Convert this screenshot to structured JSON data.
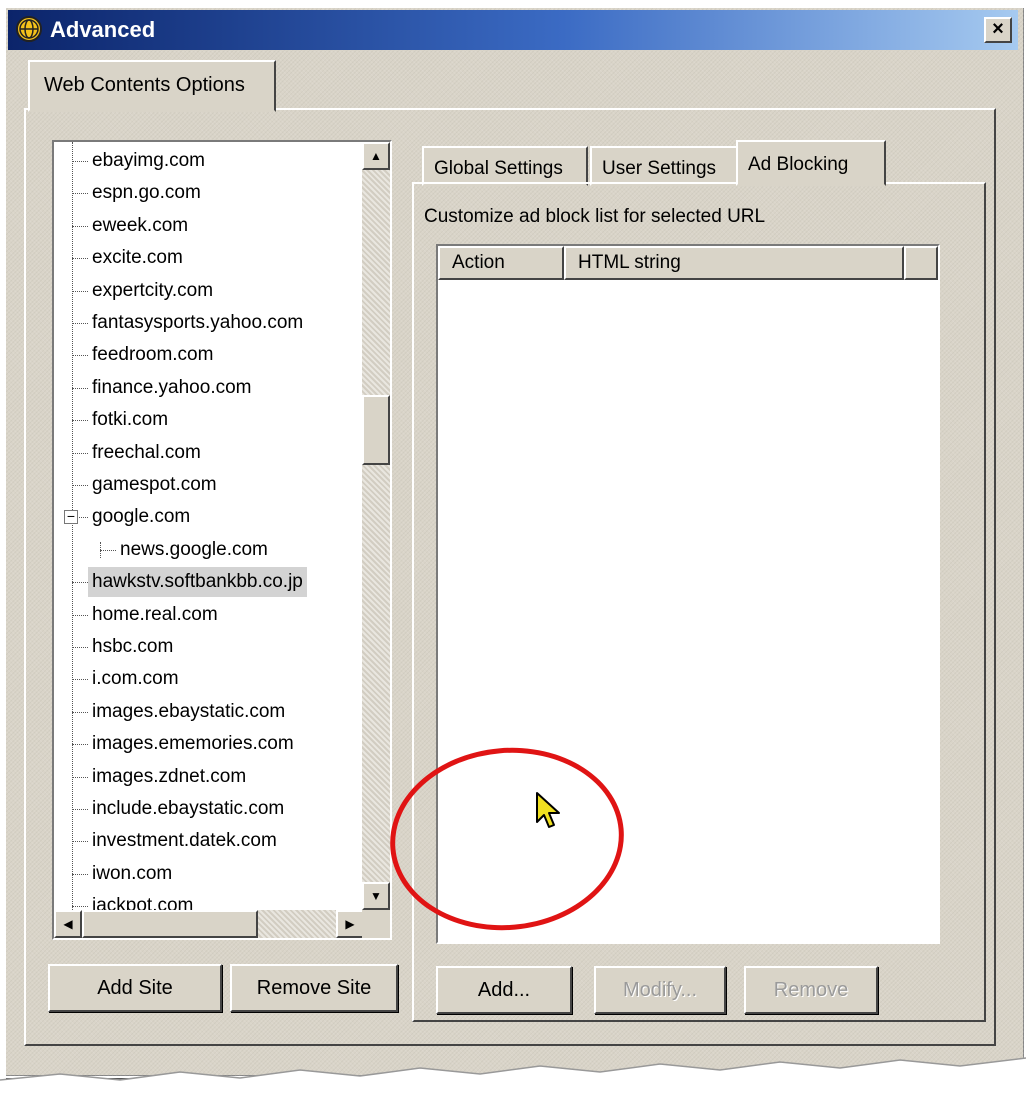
{
  "window": {
    "title": "Advanced",
    "close_label": "×"
  },
  "outer_tab": {
    "label": "Web Contents Options"
  },
  "tree": {
    "items": [
      {
        "label": "ebayimg.com",
        "level": 0
      },
      {
        "label": "espn.go.com",
        "level": 0
      },
      {
        "label": "eweek.com",
        "level": 0
      },
      {
        "label": "excite.com",
        "level": 0
      },
      {
        "label": "expertcity.com",
        "level": 0
      },
      {
        "label": "fantasysports.yahoo.com",
        "level": 0
      },
      {
        "label": "feedroom.com",
        "level": 0
      },
      {
        "label": "finance.yahoo.com",
        "level": 0
      },
      {
        "label": "fotki.com",
        "level": 0
      },
      {
        "label": "freechal.com",
        "level": 0
      },
      {
        "label": "gamespot.com",
        "level": 0
      },
      {
        "label": "google.com",
        "level": 0,
        "expanded": true
      },
      {
        "label": "news.google.com",
        "level": 1
      },
      {
        "label": "hawkstv.softbankbb.co.jp",
        "level": 0,
        "selected": true
      },
      {
        "label": "home.real.com",
        "level": 0
      },
      {
        "label": "hsbc.com",
        "level": 0
      },
      {
        "label": "i.com.com",
        "level": 0
      },
      {
        "label": "images.ebaystatic.com",
        "level": 0
      },
      {
        "label": "images.ememories.com",
        "level": 0
      },
      {
        "label": "images.zdnet.com",
        "level": 0
      },
      {
        "label": "include.ebaystatic.com",
        "level": 0
      },
      {
        "label": "investment.datek.com",
        "level": 0
      },
      {
        "label": "iwon.com",
        "level": 0
      },
      {
        "label": "jackpot.com",
        "level": 0
      }
    ],
    "vertical_scroll_position": 0.35
  },
  "buttons": {
    "add_site": "Add Site",
    "remove_site": "Remove Site",
    "add": "Add...",
    "modify": "Modify...",
    "remove": "Remove"
  },
  "tabs": [
    {
      "label": "Global Settings",
      "active": false
    },
    {
      "label": "User Settings",
      "active": false
    },
    {
      "label": "Ad Blocking",
      "active": true
    }
  ],
  "ad_blocking": {
    "description": "Customize ad block list for selected URL",
    "columns": [
      "Action",
      "HTML string"
    ]
  },
  "colors": {
    "annotation_circle": "#e01414",
    "titlebar_start": "#0b246a",
    "titlebar_end": "#a6caf0",
    "cursor": "#f0e020"
  }
}
